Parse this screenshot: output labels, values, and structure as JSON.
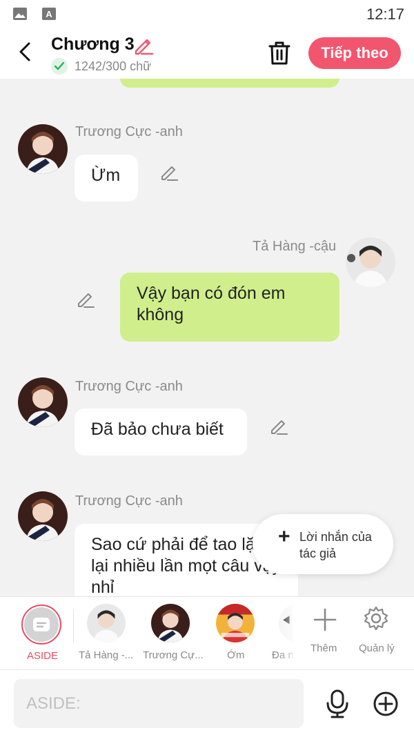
{
  "status_bar": {
    "time": "12:17",
    "icons": [
      "image-icon",
      "font-a-icon"
    ]
  },
  "header": {
    "title": "Chương 3",
    "word_count": "1242/300 chữ",
    "next_label": "Tiếp theo"
  },
  "messages": [
    {
      "side": "left",
      "sender": "Trương Cực -anh",
      "text": "Ừm"
    },
    {
      "side": "right",
      "sender": "Tả Hàng -cậu",
      "text": "Vậy bạn có đón em không"
    },
    {
      "side": "left",
      "sender": "Trương Cực -anh",
      "text": "Đã bảo chưa biết"
    },
    {
      "side": "left",
      "sender": "Trương Cực -anh",
      "text": "Sao cứ phải để tao lặp lại nhiều lần mọt câu vậy nhỉ"
    }
  ],
  "author_note": {
    "label": "Lời nhắn của tác giả"
  },
  "characters": [
    {
      "label": "ASIDE",
      "selected": true
    },
    {
      "label": "Tả Hàng -..."
    },
    {
      "label": "Trương Cự..."
    },
    {
      "label": "Ớm"
    },
    {
      "label": "Đa n"
    }
  ],
  "tools": {
    "add_label": "Thêm",
    "manage_label": "Quản lý"
  },
  "input": {
    "placeholder": "ASIDE:"
  },
  "colors": {
    "accent": "#f2566f",
    "bubble_right": "#d0ef8c",
    "aside_red": "#e64b61"
  }
}
